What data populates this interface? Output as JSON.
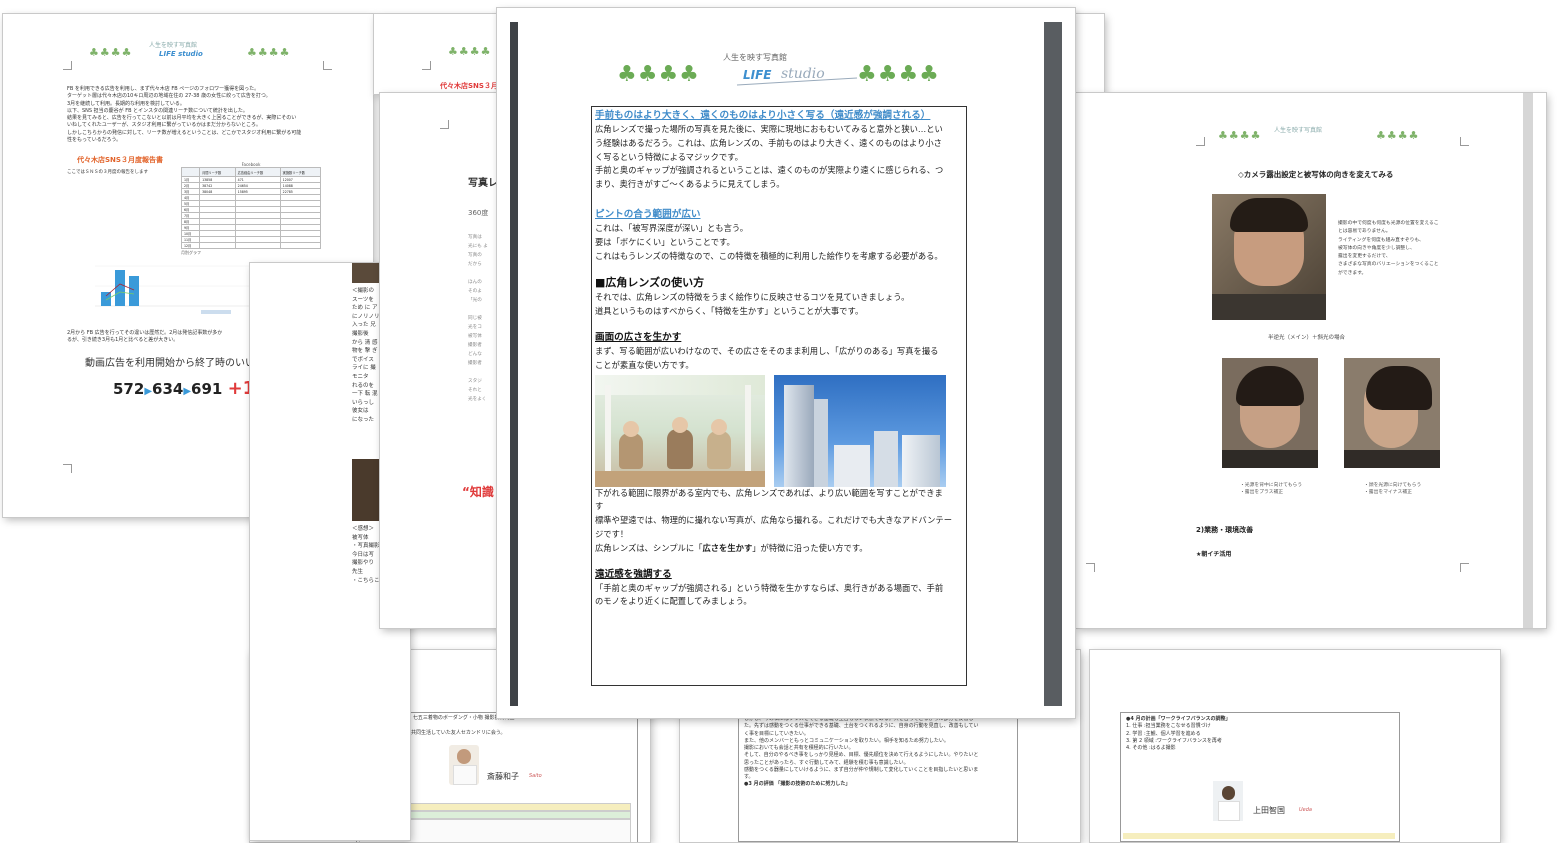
{
  "back_left": {
    "logo_sub": "人生を映す写真館",
    "logo_life": "LIFE studio",
    "body_lines": [
      "FB を利用できる広告を利用し、まず代々木店 FB ページのフォロワー獲得を図った。",
      "ターゲット層は代々木店の10キロ周辺の地域在住の 27-38 歳の女性に絞って広告を打つ。",
      "3月を継続して利用。長期的な利用を検討している。",
      "以下、SNS 担当の慶谷が FB とインスタの関連リーチ数について統計を出した。",
      "結果を見てみると、広告を行ってこないと以前は月平均を大きく上回ることができるが、実際にそのい",
      "いねしてくれたユーザーが、スタジオ利用に繋がっているかはまだ分からないところ。",
      "しかしこちらからの発信に対して、リーチ数が増えるということは、どこかでスタジオ利用に繋がる可能",
      "性をもっているだろう。"
    ],
    "report_title": "代々木店SNS３月度報告書",
    "report_note": "ここではＳＮＳの３月度の報告をします",
    "table_title": "Facebook",
    "table_headers": [
      "",
      "月間リーチ数",
      "広告経由リーチ数",
      "実施数リーチ数"
    ],
    "table_rows": [
      [
        "1月",
        "13858",
        "471",
        "12007"
      ],
      [
        "2月",
        "38742",
        "24654",
        "14088"
      ],
      [
        "3月",
        "38048",
        "15895",
        "22785"
      ],
      [
        "4月",
        "",
        "",
        ""
      ],
      [
        "5月",
        "",
        "",
        ""
      ],
      [
        "6月",
        "",
        "",
        ""
      ],
      [
        "7月",
        "",
        "",
        ""
      ],
      [
        "8月",
        "",
        "",
        ""
      ],
      [
        "9月",
        "",
        "",
        ""
      ],
      [
        "10月",
        "",
        "",
        ""
      ],
      [
        "11月",
        "",
        "",
        ""
      ],
      [
        "12月",
        "",
        "",
        ""
      ]
    ],
    "chart_title": "月別グラフ",
    "conclusion_1": "2月から FB 広告を行ってその違いは歴然だ。2月は発信記事数が多か",
    "conclusion_2": "るが、引き続き3月も1月と比べると差が大きい。",
    "video_ad_line": "動画広告を利用開始から終了時のいいね",
    "big_numbers": [
      "572",
      "634",
      "691"
    ],
    "big_plus": "+1"
  },
  "back_mid": {
    "logo_sub": "人生を映す写真館",
    "header_red": "代々木店SNS３月"
  },
  "mid_layer": {
    "title_partial": "写真レ",
    "line_360": "360度"
  },
  "left_narrow": {
    "texts": [
      "＜撮影の",
      "スーツを",
      "ため に ア",
      "にノリノリ",
      "入った 兄",
      "撮影後",
      "から 清 感",
      "物を 撃 ぎ",
      "でボイス",
      "ライに 撮",
      "モニタ",
      "れるのを",
      "一下 転 混",
      "いらっし",
      "彼女は",
      "になった",
      "＜感想＞",
      "被写体",
      "・写真撮影",
      "今日は写",
      "撮影やり",
      "先生",
      "・こちらこ"
    ],
    "red_text": "“知識"
  },
  "front": {
    "logo_sub": "人生を映す写真館",
    "logo_life": "LIFE",
    "logo_studio": "studio",
    "heading_1": "手前ものはより大きく、遠くのものはより小さく写る（遠近感が強調される）",
    "para_1": [
      "広角レンズで撮った場所の写真を見た後に、実際に現地におもむいてみると意外と狭い…とい",
      "う経験はあるだろう。これは、広角レンズの、手前ものはより大きく、遠くのものはより小さ",
      "く写るという特徴によるマジックです。",
      "手前と奥のギャップが強調されるということは、遠くのものが実際より遠くに感じられる、つ",
      "まり、奥行きがすご～くあるように見えてしまう。"
    ],
    "heading_2": "ピントの合う範囲が広い",
    "para_2": [
      "これは、「被写界深度が深い」とも言う。",
      "要は「ボケにくい」ということです。",
      "これはもうレンズの特徴なので、この特徴を積極的に利用した絵作りを考慮する必要がある。"
    ],
    "heading_3": "■広角レンズの使い方",
    "para_3": [
      "それでは、広角レンズの特徴をうまく絵作りに反映させるコツを見ていきましょう。",
      "道具というものはすべからく、「特徴を生かす」ということが大事です。"
    ],
    "heading_4": "画面の広さを生かす",
    "para_4": [
      "まず、写る範囲が広いわけなので、その広さをそのまま利用し、「広がりのある」写真を撮る",
      "ことが素直な使い方です。"
    ],
    "para_5": [
      "下がれる範囲に限界がある室内でも、広角レンズであれば、より広い範囲を写すことができま",
      "す",
      "標準や望遠では、物理的に撮れない写真が、広角なら撮れる。これだけでも大きなアドバンテー",
      "ジです！"
    ],
    "para_5_last_pre": "広角レンズは、シンプルに「",
    "para_5_last_bold": "広さを生かす",
    "para_5_last_post": "」が特徴に沿った使い方です。",
    "heading_5": "遠近感を強調する",
    "para_6": [
      "「手前と奥のギャップが強調される」という特徴を生かすならば、奥行きがある場面で、手前",
      "のモノをより近くに配置してみましょう。"
    ]
  },
  "right_page": {
    "logo_sub": "人生を映す写真館",
    "title": "◇カメラ露出設定と被写体の向きを変えてみる",
    "side_text": [
      "撮影の中で何度も何度も光源の位置を変えるこ",
      "とは容易でありません。",
      "ライティングを何度も組み直すぞりも、",
      "被写体の向きや角度を少し調整し、",
      "露出を変更するだけで、",
      "さまざまな写真のバリエーションをつくること",
      "ができます。"
    ],
    "caption_main": "半逆光（メイン）＋斜光の場合",
    "caption_left": [
      "・光源を背中に向けてもらう",
      "・露出をプラス補正"
    ],
    "caption_right": [
      "・顔を光源に向けてもらう",
      "・露出をマイナス補正"
    ],
    "section_2": "2)業務・環境改善",
    "item_1": "★朝イチ活用"
  },
  "bottom_1": {
    "lines": [
      "2. 個人学習(読書など) 七五三着物のボーダング・小物  撮影技術向上",
      "3. 第2領域",
      "友人、家族…大学時代共同生活していた友人セカンドリに会う。"
    ],
    "name": "斎藤和子",
    "sig": "Saito"
  },
  "bottom_2": {
    "lines": [
      "しかし、今の私にはプラスをできる基礎も土台もない状態である。共を合ってこなかった部分を反省し",
      "た。先ずは感動をつくる仕事ができる基礎、土台をつくれるように、自身の行動を見直し、改善もしてい",
      "く事を目標にしていきたい。",
      "また、他のメンバーともっとコミュニケーションを取りたい。相手を知るため努力したい。",
      "撮影においても会話と共有を積極的に行いたい。",
      "そして、自分のやるべき事をしっかり見極め、目標、優先順位を決めて行えるようにしたい。やりたいと",
      "思ったことがあったら、すぐ行動してみて、経験を積む事も意識したい。",
      "感動をつくる器量にしていけるように、まず自分が仲や規制して変化していくことを目指したいと思いま",
      "す。",
      "●3 月の評価 「撮影の技術のために努力した」"
    ]
  },
  "bottom_3": {
    "lines": [
      "●4 月の計画「ワークライフバランスの調整」",
      "1. 仕事 :担当業務をこなせる習慣づけ",
      "2. 学習 :主観、個人学習を進める",
      "3. 第 2 領域 :ワークライフバランスを再考",
      "4. その他 :はるよ撮影"
    ],
    "name": "上田智国",
    "sig": "Ueda"
  }
}
